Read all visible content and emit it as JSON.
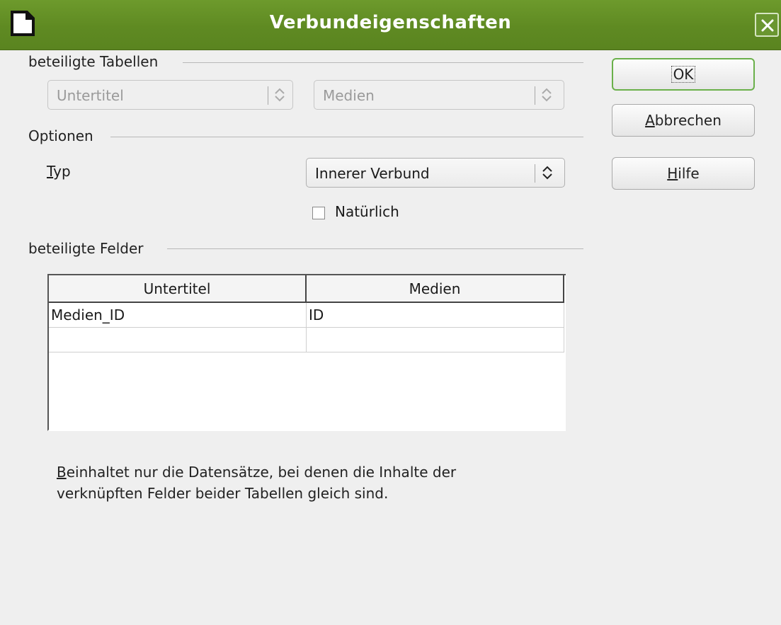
{
  "window": {
    "title": "Verbundeigenschaften"
  },
  "tables_group": {
    "label": "beteiligte Tabellen",
    "left_table": "Untertitel",
    "right_table": "Medien"
  },
  "options_group": {
    "label": "Optionen",
    "type_label_mnemonic": "T",
    "type_label_rest": "yp",
    "type_value": "Innerer Verbund",
    "natural_label": "Natürlich",
    "natural_checked": false
  },
  "fields_group": {
    "label": "beteiligte Felder",
    "columns": [
      "Untertitel",
      "Medien"
    ],
    "rows": [
      [
        "Medien_ID",
        "ID"
      ],
      [
        "",
        ""
      ]
    ]
  },
  "hint": {
    "mnemonic": "B",
    "line1_rest": "einhaltet nur die Datensätze, bei denen die Inhalte der",
    "line2": "verknüpften Felder beider Tabellen gleich sind."
  },
  "buttons": {
    "ok": "OK",
    "cancel_mnemonic": "A",
    "cancel_rest": "bbrechen",
    "help_mnemonic": "H",
    "help_rest": "ilfe"
  },
  "icons": {
    "app": "document-icon",
    "close": "close-icon",
    "spinner": "spin-updown-icon"
  },
  "colors": {
    "titlebar": "#5f8a22",
    "default_button_border": "#6ab04a"
  }
}
